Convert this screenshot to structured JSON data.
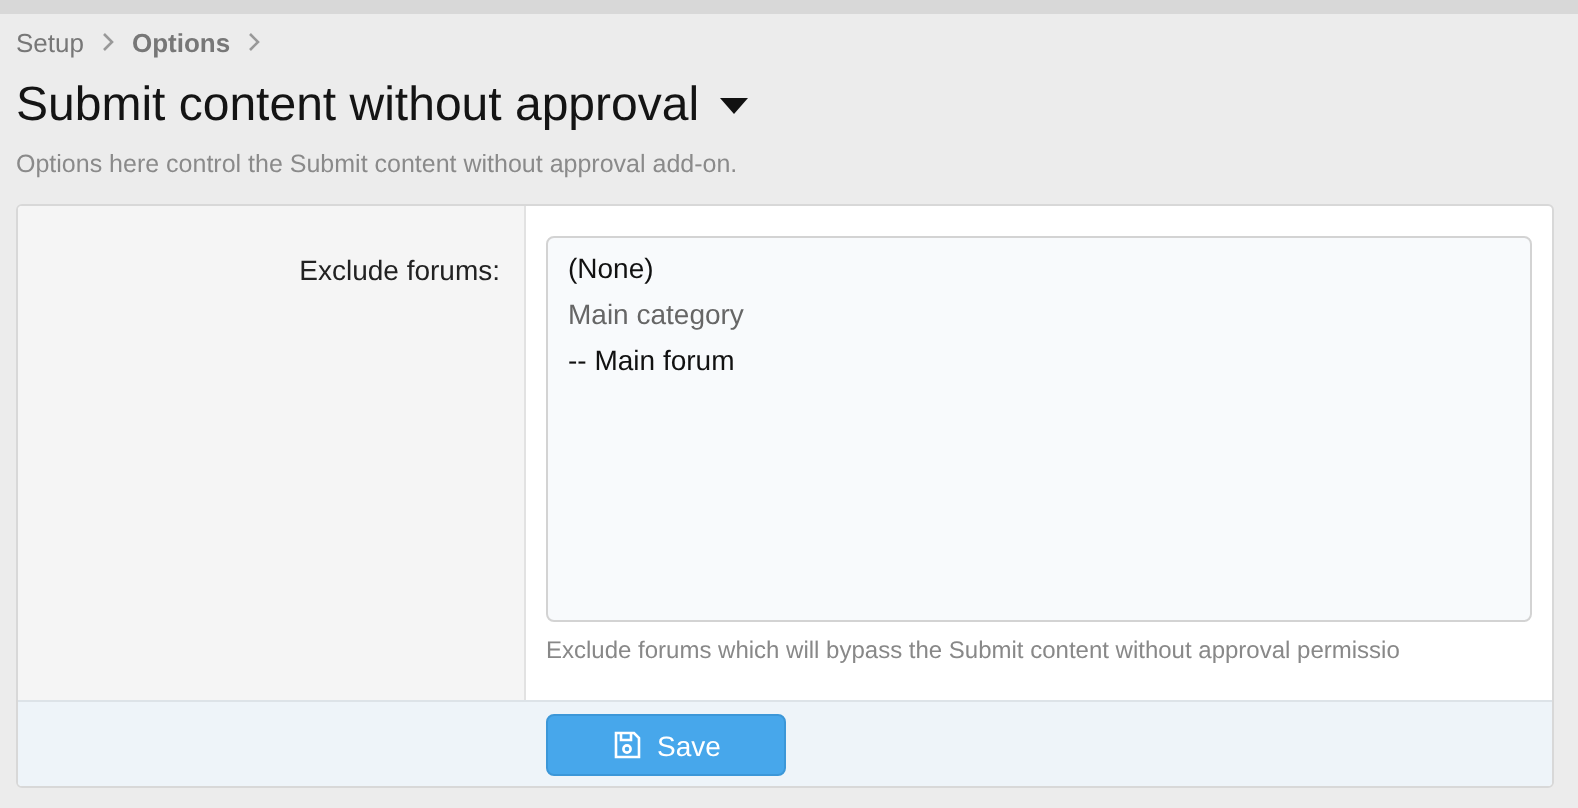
{
  "breadcrumb": [
    {
      "label": "Setup",
      "current": false
    },
    {
      "label": "Options",
      "current": true
    }
  ],
  "title": "Submit content without approval",
  "description": "Options here control the Submit content without approval add-on.",
  "option": {
    "label": "Exclude forums:",
    "items": [
      {
        "label": "(None)",
        "disabled": false
      },
      {
        "label": "Main category",
        "disabled": true
      },
      {
        "label": "-- Main forum",
        "disabled": false
      }
    ],
    "hint": "Exclude forums which will bypass the Submit content without approval permissio"
  },
  "save_button": "Save"
}
